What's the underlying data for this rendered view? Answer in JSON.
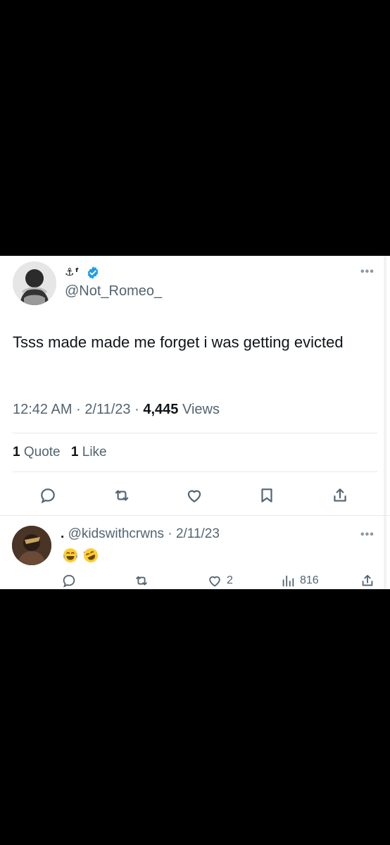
{
  "tweet": {
    "display_name": "⚓ᶠ",
    "handle": "@Not_Romeo_",
    "text": "Tsss made made me forget i was getting evicted",
    "time": "12:42 AM",
    "sep1": "·",
    "date": "2/11/23",
    "sep2": "·",
    "views_count": "4,445",
    "views_label": "Views",
    "quotes_count": "1",
    "quotes_label": "Quote",
    "likes_count": "1",
    "likes_label": "Like",
    "more": "•••"
  },
  "actions": [
    "reply-icon",
    "retweet-icon",
    "like-icon",
    "bookmark-icon",
    "share-icon"
  ],
  "reply": {
    "name": ".",
    "handle": "@kidswithcrwns",
    "sep": "·",
    "date": "2/11/23",
    "emojis": [
      "face-with-tears-of-joy",
      "rolling-on-floor-laughing"
    ],
    "likes": "2",
    "views": "816",
    "more": "•••"
  },
  "colors": {
    "verified": "#1d9bf0",
    "secondary_text": "#536471",
    "primary_text": "#0f1419",
    "divider": "#e5e8eb"
  }
}
